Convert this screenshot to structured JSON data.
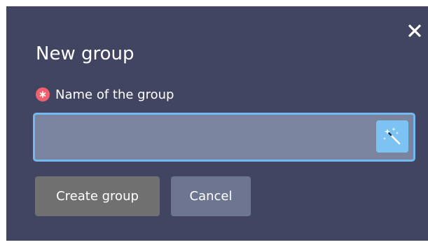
{
  "dialog": {
    "title": "New group",
    "close_icon": "close-icon",
    "field": {
      "label": "Name of the group",
      "required_icon": "asterisk-icon",
      "value": "",
      "placeholder": "",
      "magic_button_icon": "magic-wand-icon"
    },
    "buttons": {
      "create_label": "Create group",
      "cancel_label": "Cancel"
    }
  },
  "colors": {
    "dialog_background": "#424562",
    "input_background": "#7b849e",
    "input_border_focus": "#73b8f0",
    "required_badge": "#f1616d",
    "magic_button": "#7cc3f3",
    "create_button": "#707070",
    "cancel_button": "#6d7590"
  }
}
